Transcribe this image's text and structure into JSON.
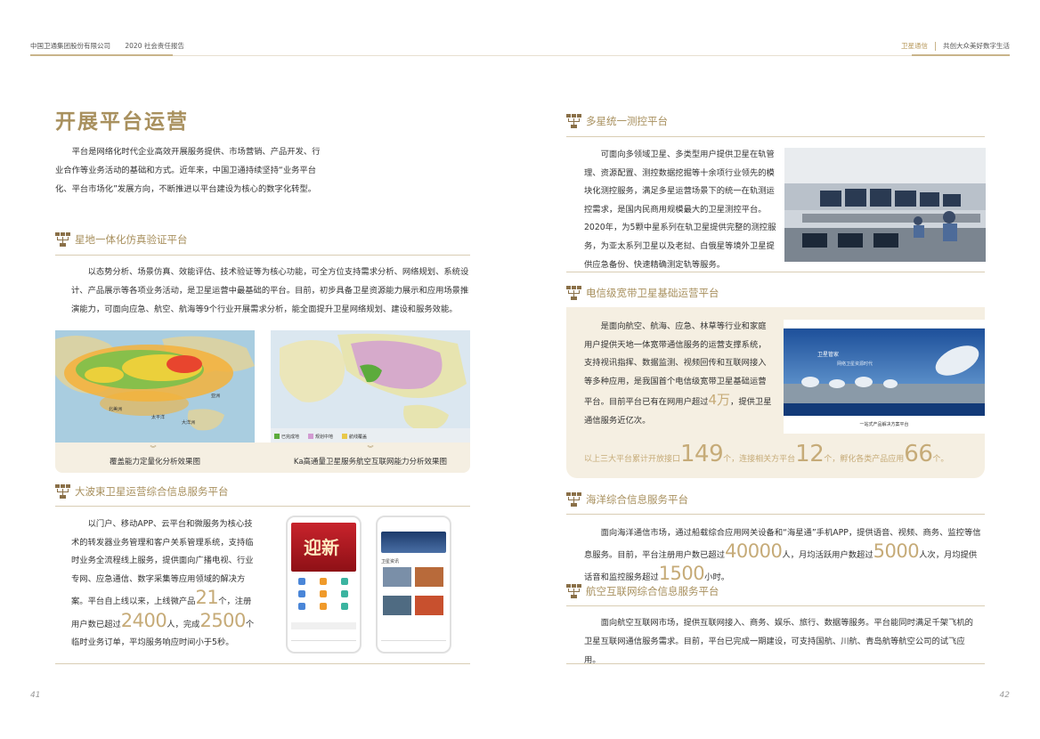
{
  "header": {
    "company": "中国卫通集团股份有限公司",
    "report": "2020 社会责任报告",
    "brand": "卫星通信",
    "slogan": "共创大众美好数字生活"
  },
  "pages": {
    "left": "41",
    "right": "42"
  },
  "left": {
    "title": "开展平台运营",
    "intro": "平台是网络化时代企业高效开展服务提供、市场营销、产品开发、行业合作等业务活动的基础和方式。近年来，中国卫通持续坚持“业务平台化、平台市场化”发展方向，不断推进以平台建设为核心的数字化转型。",
    "sec1": {
      "title": "星地一体化仿真验证平台",
      "body": "以态势分析、场景仿真、效能评估、技术验证等为核心功能，可全方位支持需求分析、网络规划、系统设计、产品展示等各项业务活动，是卫星运营中最基础的平台。目前，初步具备卫星资源能力展示和应用场景推演能力，可面向应急、航空、航海等9个行业开展需求分析，能全面提升卫星网络规划、建设和服务效能。",
      "caption1": "覆盖能力定量化分析效果图",
      "caption2": "Ka高通量卫星服务航空互联网能力分析效果图",
      "map1_labels": [
        "北美洲",
        "太平洋",
        "亚洲",
        "大洋洲"
      ],
      "map2_legend": [
        "已完成地",
        "规划中地",
        "航线覆盖"
      ]
    },
    "sec2": {
      "title": "大波束卫星运营综合信息服务平台",
      "t1": "以门户、移动APP、云平台和微服务为核心技术的转发器业务管理和客户关系管理系统，支持临时业务全流程线上服务，提供面向广播电视、行业专网、应急通信、数字采集等应用领域的解决方案。平台自上线以来，上线微产品",
      "n1": "21",
      "t2": "个，注册用户数已超过",
      "n2": "2400",
      "t3": "人，完成",
      "n3": "2500",
      "t4": "个临时业务订单，平均服务响应时间小于5秒。",
      "phone1_banner": "迎新",
      "phone2_title": "卫星资讯"
    }
  },
  "right": {
    "sec1": {
      "title": "多星统一测控平台",
      "body": "可面向多领域卫星、多类型用户提供卫星在轨管理、资源配置、测控数据挖掘等十余项行业领先的模块化测控服务，满足多星运营场景下的统一在轨测运控需求，是国内民商用规模最大的卫星测控平台。2020年，为5颗中星系列在轨卫星提供完整的测控服务，为亚太系列卫星以及老挝、白俄星等境外卫星提供应急备份、快速精确测定轨等服务。"
    },
    "sec2": {
      "title": "电信级宽带卫星基础运营平台",
      "t1": "是面向航空、航海、应急、林草等行业和家庭用户提供天地一体宽带通信服务的运营支撑系统，支持视讯指挥、数据监测、视频回传和互联网接入等多种应用，是我国首个电信级宽带卫星基础运营平台。目前平台已有在网用户超过",
      "n1": "4万",
      "t2": "，提供卫星通信服务近亿次。",
      "stats_t1": "以上三大平台累计开放接口",
      "stats_n1": "149",
      "stats_t2": "个，连接相关方平台",
      "stats_n2": "12",
      "stats_t3": "个，孵化各类产品应用",
      "stats_n3": "66",
      "stats_t4": "个。",
      "web_banner": "卫星管家",
      "web_sub": "网络卫星资源时代",
      "web_footer": "一站式产品解决方案平台"
    },
    "sec3": {
      "title": "海洋综合信息服务平台",
      "t1": "面向海洋通信市场，通过船载综合应用网关设备和“海星通”手机APP，提供语音、视频、商务、监控等信息服务。目前，平台注册用户数已超过",
      "n1": "40000",
      "t2": "人，月均活跃用户数超过",
      "n2": "5000",
      "t3": "人次，月均提供话音和监控服务超过",
      "n3": "1500",
      "t4": "小时。"
    },
    "sec4": {
      "title": "航空互联网综合信息服务平台",
      "body": "面向航空互联网市场，提供互联网接入、商务、娱乐、旅行、数据等服务。平台能同时满足千架飞机的卫星互联网通信服务需求。目前，平台已完成一期建设，可支持国航、川航、青岛航等航空公司的试飞应用。"
    }
  },
  "colors": {
    "gold": "#a8905e",
    "highlight": "#c6ab78",
    "card": "#f5efe2",
    "icon": "#8a7048"
  }
}
